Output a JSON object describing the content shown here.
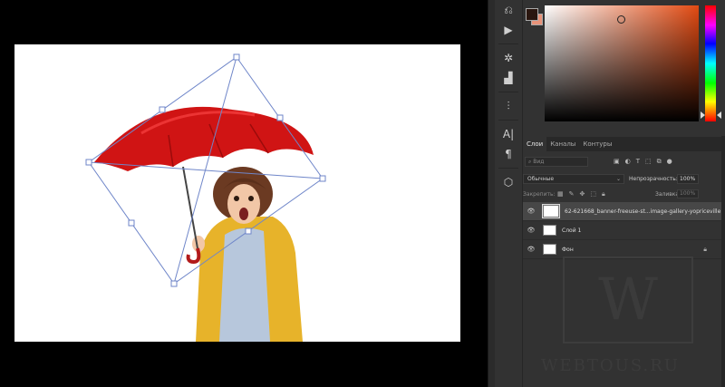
{
  "colors": {
    "foreground": "#2a160f",
    "background": "#e8937a",
    "picker_hue": "#e24a12"
  },
  "tools": [
    {
      "name": "history-icon",
      "glyph": "⎌"
    },
    {
      "name": "play-icon",
      "glyph": "▶"
    },
    {
      "name": "brush-settings-icon",
      "glyph": "✲"
    },
    {
      "name": "brushes-icon",
      "glyph": "▟"
    },
    {
      "name": "channels-icon",
      "glyph": "⫶"
    },
    {
      "name": "character-icon",
      "glyph": "A|"
    },
    {
      "name": "paragraph-icon",
      "glyph": "¶"
    },
    {
      "name": "3d-icon",
      "glyph": "⬡"
    }
  ],
  "panel": {
    "tabs": [
      "Слои",
      "Каналы",
      "Контуры"
    ],
    "search_placeholder": "Вид",
    "blend_mode": "Обычные",
    "opacity_label": "Непрозрачность:",
    "opacity_value": "100%",
    "lock_label": "Закрепить:",
    "fill_label": "Заливка:",
    "fill_value": "100%"
  },
  "layers": [
    {
      "name": "62-621668_banner-freeuse-st...image-gallery-yopriceville",
      "selected": true,
      "locked": false
    },
    {
      "name": "Слой 1",
      "selected": false,
      "locked": false
    },
    {
      "name": "Фон",
      "selected": false,
      "locked": true
    }
  ],
  "watermark": {
    "letter": "W",
    "text": "WEBTOUS.RU"
  }
}
